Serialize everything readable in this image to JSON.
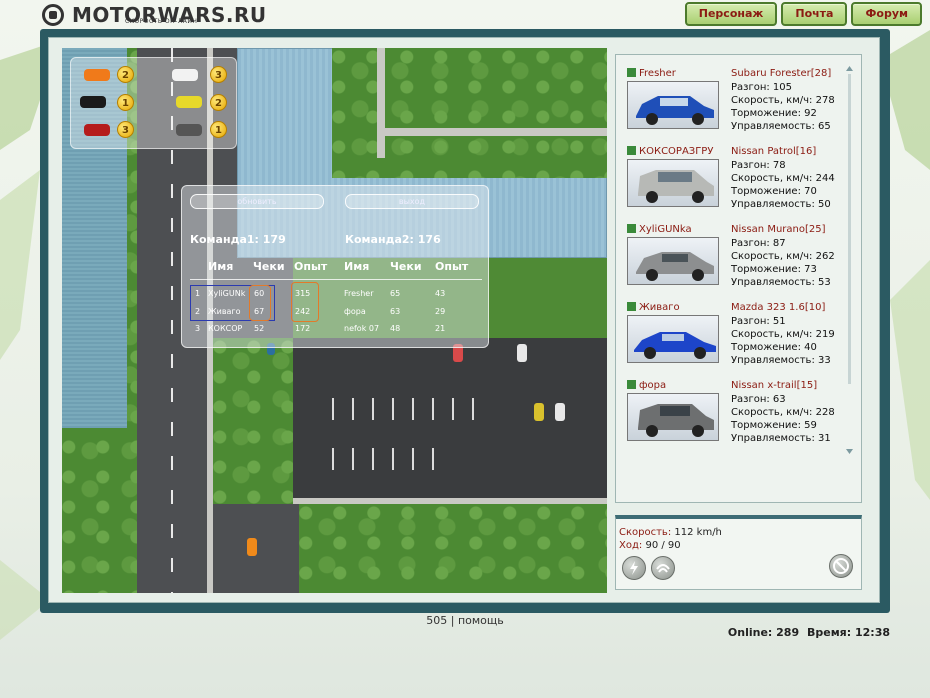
{
  "header": {
    "logo_text": "MOTORWARS.RU",
    "logo_sub": "СКОРОСТЬ ОН-ЛАЙН",
    "nav": [
      "Персонаж",
      "Почта",
      "Форум"
    ]
  },
  "hud": {
    "cars": [
      {
        "color": "#f07a1a",
        "count": "2"
      },
      {
        "color": "#f2f2f2",
        "count": "3"
      },
      {
        "color": "#1a1a1a",
        "count": "1"
      },
      {
        "color": "#e7d92a",
        "count": "2"
      },
      {
        "color": "#b51c1c",
        "count": "3"
      },
      {
        "color": "#555555",
        "count": "1"
      }
    ]
  },
  "scoreboard": {
    "refresh_label": "обновить",
    "exit_label": "выход",
    "team1": {
      "label": "Команда1:",
      "score": "179"
    },
    "team2": {
      "label": "Команда2:",
      "score": "176"
    },
    "headers": [
      "Имя",
      "Чеки",
      "Опыт",
      "Имя",
      "Чеки",
      "Опыт"
    ],
    "rows": [
      {
        "n": "1",
        "name1": "XyliGUNk",
        "checks1": "60",
        "exp1": "315",
        "name2": "Fresher",
        "checks2": "65",
        "exp2": "43"
      },
      {
        "n": "2",
        "name1": "Живаго",
        "checks1": "67",
        "exp1": "242",
        "name2": "фора",
        "checks2": "63",
        "exp2": "29"
      },
      {
        "n": "3",
        "name1": "КОКСОР",
        "checks1": "52",
        "exp1": "172",
        "name2": "nefok 07",
        "checks2": "48",
        "exp2": "21"
      }
    ]
  },
  "players": [
    {
      "name": "Fresher",
      "car": "Subaru Forester[28]",
      "accel": "Разгон: 105",
      "speed": "Скорость, км/ч: 278",
      "brake": "Торможение: 92",
      "handling": "Управляемость: 65",
      "car_color": "#1f4fb8",
      "icon_color": "#3a8a3a"
    },
    {
      "name": "КОКСОРАЗГРУ",
      "car": "Nissan Patrol[16]",
      "accel": "Разгон: 78",
      "speed": "Скорость, км/ч: 244",
      "brake": "Торможение: 70",
      "handling": "Управляемость: 50",
      "car_color": "#b7b9b6",
      "icon_color": "#3a8a3a"
    },
    {
      "name": "XyliGUNka",
      "car": "Nissan Murano[25]",
      "accel": "Разгон: 87",
      "speed": "Скорость, км/ч: 262",
      "brake": "Торможение: 73",
      "handling": "Управляемость: 53",
      "car_color": "#8d8f90",
      "icon_color": "#3a8a3a"
    },
    {
      "name": "Живаго",
      "car": "Mazda 323 1.6[10]",
      "accel": "Разгон: 51",
      "speed": "Скорость, км/ч: 219",
      "brake": "Торможение: 40",
      "handling": "Управляемость: 33",
      "car_color": "#1d45c9",
      "icon_color": "#3a8a3a"
    },
    {
      "name": "фора",
      "car": "Nissan x-trail[15]",
      "accel": "Разгон: 63",
      "speed": "Скорость, км/ч: 228",
      "brake": "Торможение: 59",
      "handling": "Управляемость: 31",
      "car_color": "#6d6f70",
      "icon_color": "#3a8a3a"
    }
  ],
  "status_panel": {
    "speed_label": "Скорость:",
    "speed_value": "112 km/h",
    "moves_label": "Ход:",
    "moves_value": "90 / 90"
  },
  "footer": {
    "link1": "505",
    "sep": "|",
    "link2": "помощь",
    "online_label": "Online:",
    "online_value": "289",
    "time_label": "Время:",
    "time_value": "12:38"
  }
}
